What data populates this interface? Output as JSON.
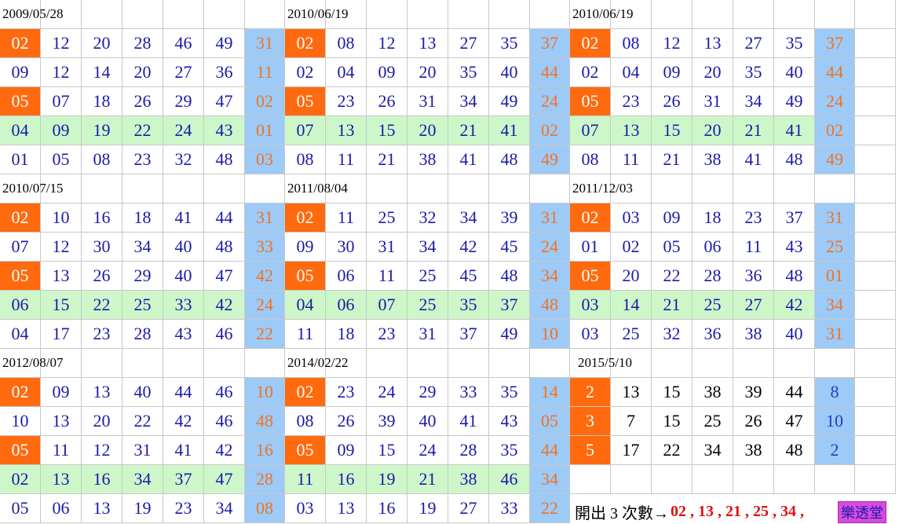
{
  "blocks": [
    {
      "date": "2009/05/28",
      "rows": [
        [
          "02",
          "12",
          "20",
          "28",
          "46",
          "49",
          "31"
        ],
        [
          "09",
          "12",
          "14",
          "20",
          "27",
          "36",
          "11"
        ],
        [
          "05",
          "07",
          "18",
          "26",
          "29",
          "47",
          "02"
        ],
        [
          "04",
          "09",
          "19",
          "22",
          "24",
          "43",
          "01"
        ],
        [
          "01",
          "05",
          "08",
          "23",
          "32",
          "48",
          "03"
        ]
      ]
    },
    {
      "date": "2010/06/19",
      "rows": [
        [
          "02",
          "08",
          "12",
          "13",
          "27",
          "35",
          "37"
        ],
        [
          "02",
          "04",
          "09",
          "20",
          "35",
          "40",
          "44"
        ],
        [
          "05",
          "23",
          "26",
          "31",
          "34",
          "49",
          "24"
        ],
        [
          "07",
          "13",
          "15",
          "20",
          "21",
          "41",
          "02"
        ],
        [
          "08",
          "11",
          "21",
          "38",
          "41",
          "48",
          "49"
        ]
      ]
    },
    {
      "date": "2010/06/19",
      "rows": [
        [
          "02",
          "08",
          "12",
          "13",
          "27",
          "35",
          "37"
        ],
        [
          "02",
          "04",
          "09",
          "20",
          "35",
          "40",
          "44"
        ],
        [
          "05",
          "23",
          "26",
          "31",
          "34",
          "49",
          "24"
        ],
        [
          "07",
          "13",
          "15",
          "20",
          "21",
          "41",
          "02"
        ],
        [
          "08",
          "11",
          "21",
          "38",
          "41",
          "48",
          "49"
        ]
      ]
    },
    {
      "date": "2010/07/15",
      "rows": [
        [
          "02",
          "10",
          "16",
          "18",
          "41",
          "44",
          "31"
        ],
        [
          "07",
          "12",
          "30",
          "34",
          "40",
          "48",
          "33"
        ],
        [
          "05",
          "13",
          "26",
          "29",
          "40",
          "47",
          "42"
        ],
        [
          "06",
          "15",
          "22",
          "25",
          "33",
          "42",
          "24"
        ],
        [
          "04",
          "17",
          "23",
          "28",
          "43",
          "46",
          "22"
        ]
      ]
    },
    {
      "date": "2011/08/04",
      "rows": [
        [
          "02",
          "11",
          "25",
          "32",
          "34",
          "39",
          "31"
        ],
        [
          "09",
          "30",
          "31",
          "34",
          "42",
          "45",
          "24"
        ],
        [
          "05",
          "06",
          "11",
          "25",
          "45",
          "48",
          "34"
        ],
        [
          "04",
          "06",
          "07",
          "25",
          "35",
          "37",
          "48"
        ],
        [
          "11",
          "18",
          "23",
          "31",
          "37",
          "49",
          "10"
        ]
      ]
    },
    {
      "date": "2011/12/03",
      "rows": [
        [
          "02",
          "03",
          "09",
          "18",
          "23",
          "37",
          "31"
        ],
        [
          "01",
          "02",
          "05",
          "06",
          "11",
          "43",
          "25"
        ],
        [
          "05",
          "20",
          "22",
          "28",
          "36",
          "48",
          "01"
        ],
        [
          "03",
          "14",
          "21",
          "25",
          "27",
          "42",
          "34"
        ],
        [
          "03",
          "25",
          "32",
          "36",
          "38",
          "40",
          "31"
        ]
      ]
    },
    {
      "date": "2012/08/07",
      "rows": [
        [
          "02",
          "09",
          "13",
          "40",
          "44",
          "46",
          "10"
        ],
        [
          "10",
          "13",
          "20",
          "22",
          "42",
          "46",
          "48"
        ],
        [
          "05",
          "11",
          "12",
          "31",
          "41",
          "42",
          "16"
        ],
        [
          "02",
          "13",
          "16",
          "34",
          "37",
          "47",
          "28"
        ],
        [
          "05",
          "06",
          "13",
          "19",
          "23",
          "34",
          "08"
        ]
      ]
    },
    {
      "date": "2014/02/22",
      "rows": [
        [
          "02",
          "23",
          "24",
          "29",
          "33",
          "35",
          "14"
        ],
        [
          "08",
          "26",
          "39",
          "40",
          "41",
          "43",
          "05"
        ],
        [
          "05",
          "09",
          "15",
          "24",
          "28",
          "35",
          "44"
        ],
        [
          "11",
          "16",
          "19",
          "21",
          "38",
          "46",
          "34"
        ],
        [
          "03",
          "13",
          "16",
          "19",
          "27",
          "33",
          "22"
        ]
      ]
    },
    {
      "date": "2015/5/10",
      "rows": [
        [
          "2",
          "13",
          "15",
          "38",
          "39",
          "44",
          "8"
        ],
        [
          "3",
          "7",
          "15",
          "25",
          "26",
          "47",
          "10"
        ],
        [
          "5",
          "17",
          "22",
          "34",
          "38",
          "48",
          "2"
        ]
      ]
    }
  ],
  "summary": {
    "label": "開出 3 次數→",
    "numbers": "02 , 13 , 21 , 25 , 34 ,"
  },
  "logo": "樂透堂",
  "colors": {
    "orange": "#ff6a0f",
    "blue": "#9dcaf6",
    "green": "#cdf7c9",
    "number": "#1a1aa8",
    "special": "#f07324"
  }
}
